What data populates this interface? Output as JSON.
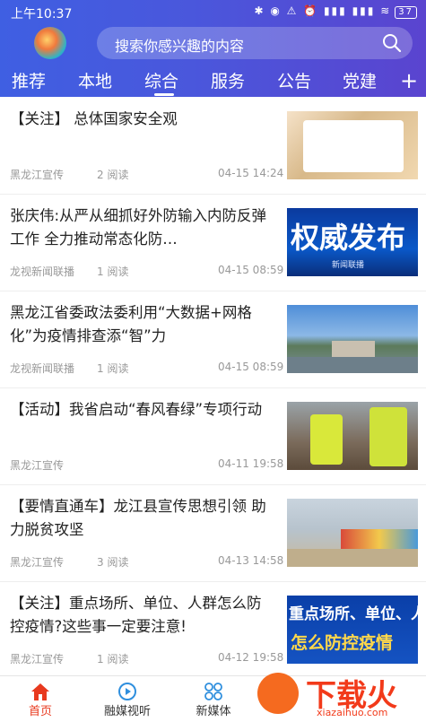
{
  "status": {
    "time": "上午10:37",
    "battery": "37"
  },
  "search": {
    "placeholder": "搜索你感兴趣的内容"
  },
  "tabs": [
    "推荐",
    "本地",
    "综合",
    "服务",
    "公告",
    "党建"
  ],
  "active_tab": "综合",
  "add_tab_label": "+",
  "news": [
    {
      "title": "【关注】          总体国家安全观",
      "source": "黑龙江宣传",
      "reads": "2 阅读",
      "time": "04-15 14:24"
    },
    {
      "title": "张庆伟:从严从细抓好外防输入内防反弹工作 全力推动常态化防…",
      "source": "龙视新闻联播",
      "reads": "1 阅读",
      "time": "04-15 08:59",
      "thumb_text": "权威发布",
      "thumb_sub": "新闻联播"
    },
    {
      "title": "黑龙江省委政法委利用“大数据+网格化”为疫情排查添“智”力",
      "source": "龙视新闻联播",
      "reads": "1 阅读",
      "time": "04-15 08:59"
    },
    {
      "title": "【活动】我省启动“春风春绿”专项行动",
      "source": "黑龙江宣传",
      "reads": "",
      "time": "04-11 19:58"
    },
    {
      "title": "【要情直通车】龙江县宣传思想引领 助力脱贫攻坚",
      "source": "黑龙江宣传",
      "reads": "3 阅读",
      "time": "04-13 14:58"
    },
    {
      "title": "【关注】重点场所、单位、人群怎么防控疫情?这些事一定要注意!",
      "source": "黑龙江宣传",
      "reads": "1 阅读",
      "time": "04-12 19:58",
      "thumb_text": "重点场所、单位、人群",
      "thumb_sub": "怎么防控疫情"
    }
  ],
  "bottom_nav": [
    {
      "label": "首页",
      "icon": "home-icon",
      "active": true
    },
    {
      "label": "融媒视听",
      "icon": "play-icon",
      "active": false
    },
    {
      "label": "新媒体",
      "icon": "grid-icon",
      "active": false
    }
  ],
  "watermark": {
    "text": "下载火",
    "domain": "xiazaihuo.com"
  },
  "colors": {
    "header_start": "#3f5fe2",
    "header_end": "#5a44cf",
    "accent_red": "#e8391e"
  }
}
